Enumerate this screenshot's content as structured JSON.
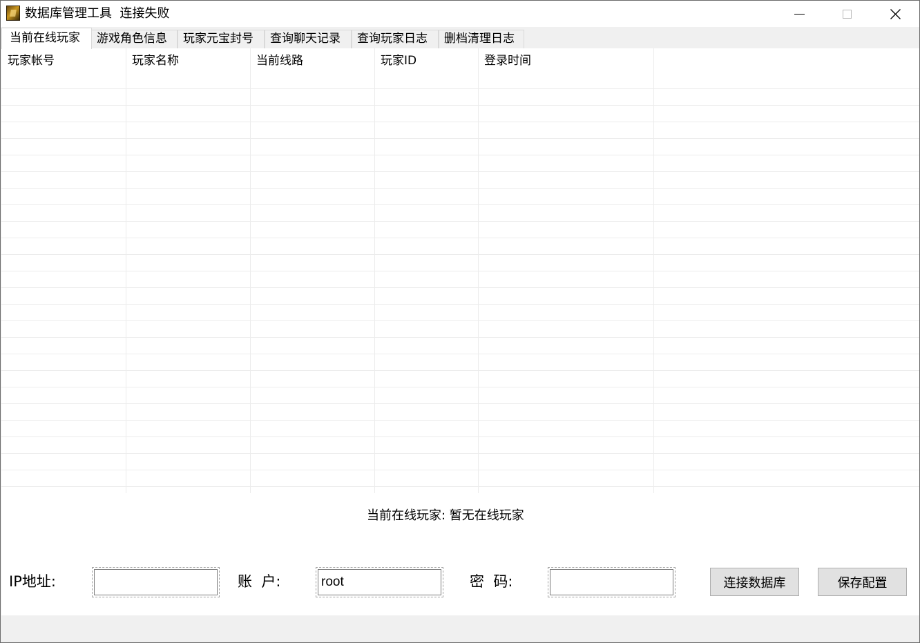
{
  "window": {
    "title": "数据库管理工具  连接失败"
  },
  "tabs": [
    {
      "label": "当前在线玩家",
      "active": true
    },
    {
      "label": "游戏角色信息",
      "active": false
    },
    {
      "label": "玩家元宝封号",
      "active": false
    },
    {
      "label": "查询聊天记录",
      "active": false
    },
    {
      "label": "查询玩家日志",
      "active": false
    },
    {
      "label": "删档清理日志",
      "active": false
    }
  ],
  "table": {
    "columns": [
      "玩家帐号",
      "玩家名称",
      "当前线路",
      "玩家ID",
      "登录时间"
    ],
    "rows": []
  },
  "status": {
    "text": "当前在线玩家: 暂无在线玩家"
  },
  "form": {
    "ip_label": "IP地址:",
    "ip_value": "",
    "account_label": "账  户:",
    "account_value": "root",
    "password_label": "密  码:",
    "password_value": "",
    "connect_button": "连接数据库",
    "save_button": "保存配置"
  }
}
